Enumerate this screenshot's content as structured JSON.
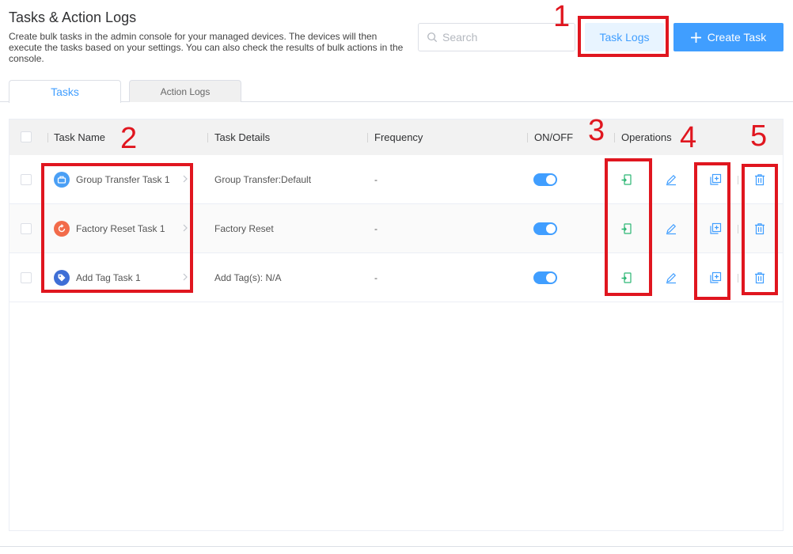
{
  "header": {
    "title": "Tasks & Action Logs",
    "description": "Create bulk tasks in the admin console for your managed devices. The devices will then execute the tasks based on your settings. You can also check the results of bulk actions in the console."
  },
  "search": {
    "placeholder": "Search",
    "value": ""
  },
  "buttons": {
    "task_logs": "Task Logs",
    "create_task": "Create Task"
  },
  "tabs": [
    {
      "label": "Tasks",
      "active": true
    },
    {
      "label": "Action Logs",
      "active": false
    }
  ],
  "table": {
    "columns": [
      "Task Name",
      "Task Details",
      "Frequency",
      "ON/OFF",
      "Operations"
    ],
    "rows": [
      {
        "name": "Group Transfer Task 1",
        "icon": "group-transfer-icon",
        "icon_color": "#4a9ff5",
        "details": "Group Transfer:Default",
        "frequency": "-",
        "enabled": true
      },
      {
        "name": "Factory Reset Task 1",
        "icon": "factory-reset-icon",
        "icon_color": "#f26b4a",
        "details": "Factory Reset",
        "frequency": "-",
        "enabled": true
      },
      {
        "name": "Add Tag Task 1",
        "icon": "tag-icon",
        "icon_color": "#3f6fd6",
        "details": "Add Tag(s): N/A",
        "frequency": "-",
        "enabled": true
      }
    ]
  },
  "annotations": [
    "1",
    "2",
    "3",
    "4",
    "5"
  ],
  "colors": {
    "accent": "#409eff",
    "annotation": "#e0161f",
    "run_icon": "#2bb673"
  }
}
